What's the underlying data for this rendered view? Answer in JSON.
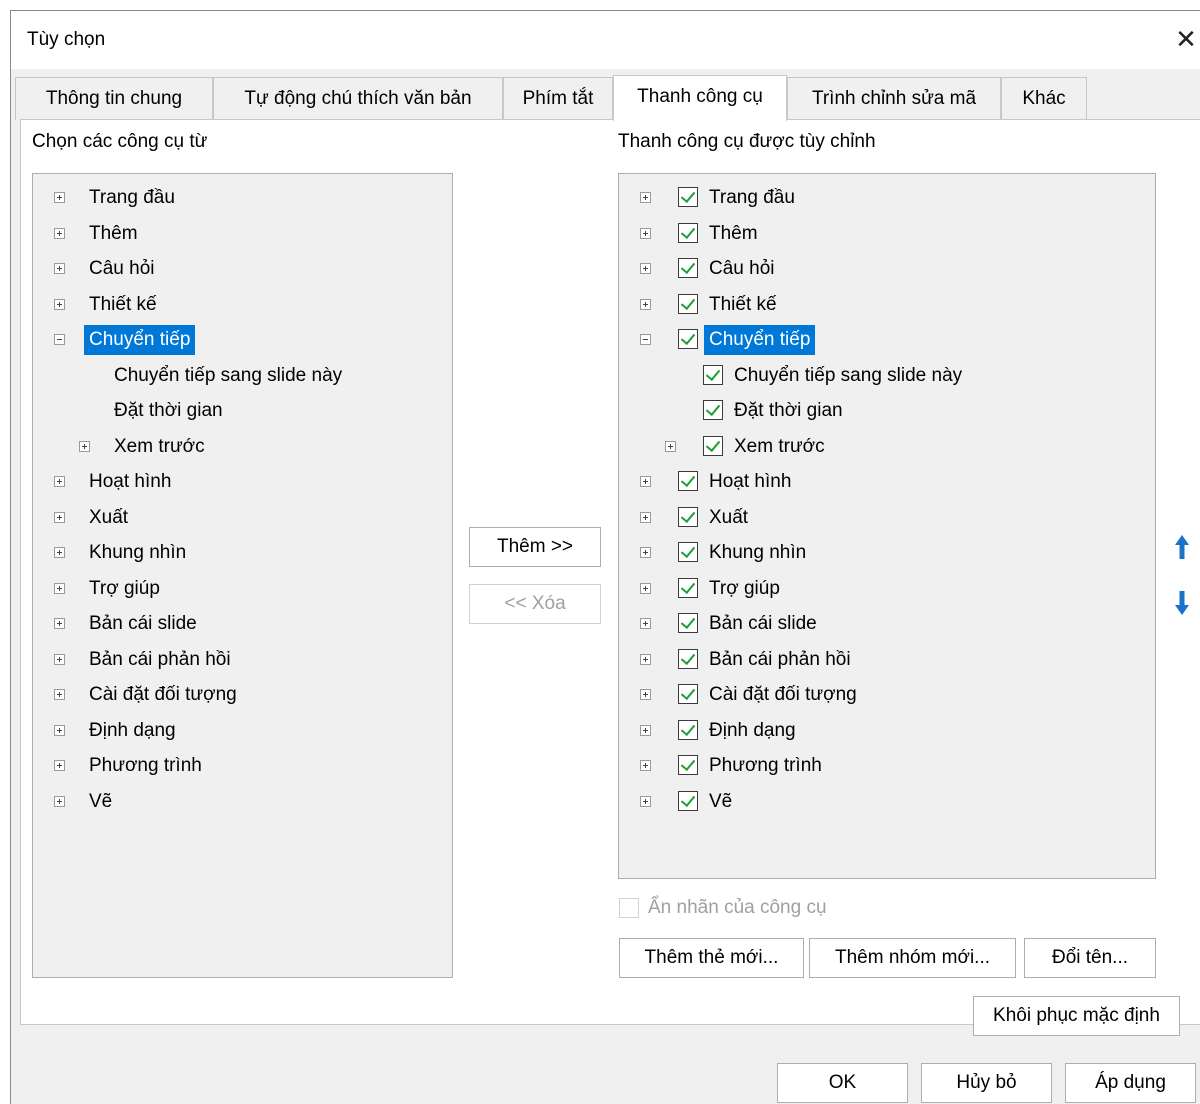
{
  "window": {
    "title": "Tùy chọn",
    "close_glyph": "✕"
  },
  "tabs": [
    {
      "label": "Thông tin chung",
      "active": false
    },
    {
      "label": "Tự động chú thích văn bản",
      "active": false
    },
    {
      "label": "Phím tắt",
      "active": false
    },
    {
      "label": "Thanh công cụ",
      "active": true
    },
    {
      "label": "Trình chỉnh sửa mã",
      "active": false
    },
    {
      "label": "Khác",
      "active": false
    }
  ],
  "left": {
    "heading": "Chọn các công cụ từ",
    "items": [
      {
        "label": "Trang đầu",
        "expander": "plus",
        "level": 0
      },
      {
        "label": "Thêm",
        "expander": "plus",
        "level": 0
      },
      {
        "label": "Câu hỏi",
        "expander": "plus",
        "level": 0
      },
      {
        "label": "Thiết kế",
        "expander": "plus",
        "level": 0
      },
      {
        "label": "Chuyển tiếp",
        "expander": "minus",
        "level": 0,
        "selected": true
      },
      {
        "label": "Chuyển tiếp sang slide này",
        "expander": "none",
        "level": 1
      },
      {
        "label": "Đặt thời gian",
        "expander": "none",
        "level": 1
      },
      {
        "label": "Xem trước",
        "expander": "plus",
        "level": 1
      },
      {
        "label": "Hoạt hình",
        "expander": "plus",
        "level": 0
      },
      {
        "label": "Xuất",
        "expander": "plus",
        "level": 0
      },
      {
        "label": "Khung nhìn",
        "expander": "plus",
        "level": 0
      },
      {
        "label": "Trợ giúp",
        "expander": "plus",
        "level": 0
      },
      {
        "label": "Bản cái slide",
        "expander": "plus",
        "level": 0
      },
      {
        "label": "Bản cái phản hồi",
        "expander": "plus",
        "level": 0
      },
      {
        "label": "Cài đặt đối tượng",
        "expander": "plus",
        "level": 0
      },
      {
        "label": "Định dạng",
        "expander": "plus",
        "level": 0
      },
      {
        "label": "Phương trình",
        "expander": "plus",
        "level": 0
      },
      {
        "label": "Vẽ",
        "expander": "plus",
        "level": 0
      }
    ]
  },
  "middle": {
    "add_label": "Thêm >>",
    "remove_label": "<< Xóa"
  },
  "right": {
    "heading": "Thanh công cụ được tùy chỉnh",
    "items": [
      {
        "label": "Trang đầu",
        "expander": "plus",
        "level": 0,
        "checked": true
      },
      {
        "label": "Thêm",
        "expander": "plus",
        "level": 0,
        "checked": true
      },
      {
        "label": "Câu hỏi",
        "expander": "plus",
        "level": 0,
        "checked": true
      },
      {
        "label": "Thiết kế",
        "expander": "plus",
        "level": 0,
        "checked": true
      },
      {
        "label": "Chuyển tiếp",
        "expander": "minus",
        "level": 0,
        "checked": true,
        "selected": true
      },
      {
        "label": "Chuyển tiếp sang slide này",
        "expander": "none",
        "level": 1,
        "checked": true
      },
      {
        "label": "Đặt thời gian",
        "expander": "none",
        "level": 1,
        "checked": true
      },
      {
        "label": "Xem trước",
        "expander": "plus",
        "level": 1,
        "checked": true
      },
      {
        "label": "Hoạt hình",
        "expander": "plus",
        "level": 0,
        "checked": true
      },
      {
        "label": "Xuất",
        "expander": "plus",
        "level": 0,
        "checked": true
      },
      {
        "label": "Khung nhìn",
        "expander": "plus",
        "level": 0,
        "checked": true
      },
      {
        "label": "Trợ giúp",
        "expander": "plus",
        "level": 0,
        "checked": true
      },
      {
        "label": "Bản cái slide",
        "expander": "plus",
        "level": 0,
        "checked": true
      },
      {
        "label": "Bản cái phản hồi",
        "expander": "plus",
        "level": 0,
        "checked": true
      },
      {
        "label": "Cài đặt đối tượng",
        "expander": "plus",
        "level": 0,
        "checked": true
      },
      {
        "label": "Định dạng",
        "expander": "plus",
        "level": 0,
        "checked": true
      },
      {
        "label": "Phương trình",
        "expander": "plus",
        "level": 0,
        "checked": true
      },
      {
        "label": "Vẽ",
        "expander": "plus",
        "level": 0,
        "checked": true
      }
    ],
    "move_up_icon": "arrow-up-icon",
    "move_down_icon": "arrow-down-icon",
    "hide_labels": "Ẩn nhãn của công cụ",
    "new_tab": "Thêm thẻ mới...",
    "new_group": "Thêm nhóm mới...",
    "rename": "Đổi tên...",
    "restore": "Khôi phục mặc định"
  },
  "footer": {
    "ok": "OK",
    "cancel": "Hủy bỏ",
    "apply": "Áp dụng"
  },
  "colors": {
    "selection": "#0078d7",
    "checkmark": "#1e9e32",
    "arrow": "#1a73c8"
  }
}
